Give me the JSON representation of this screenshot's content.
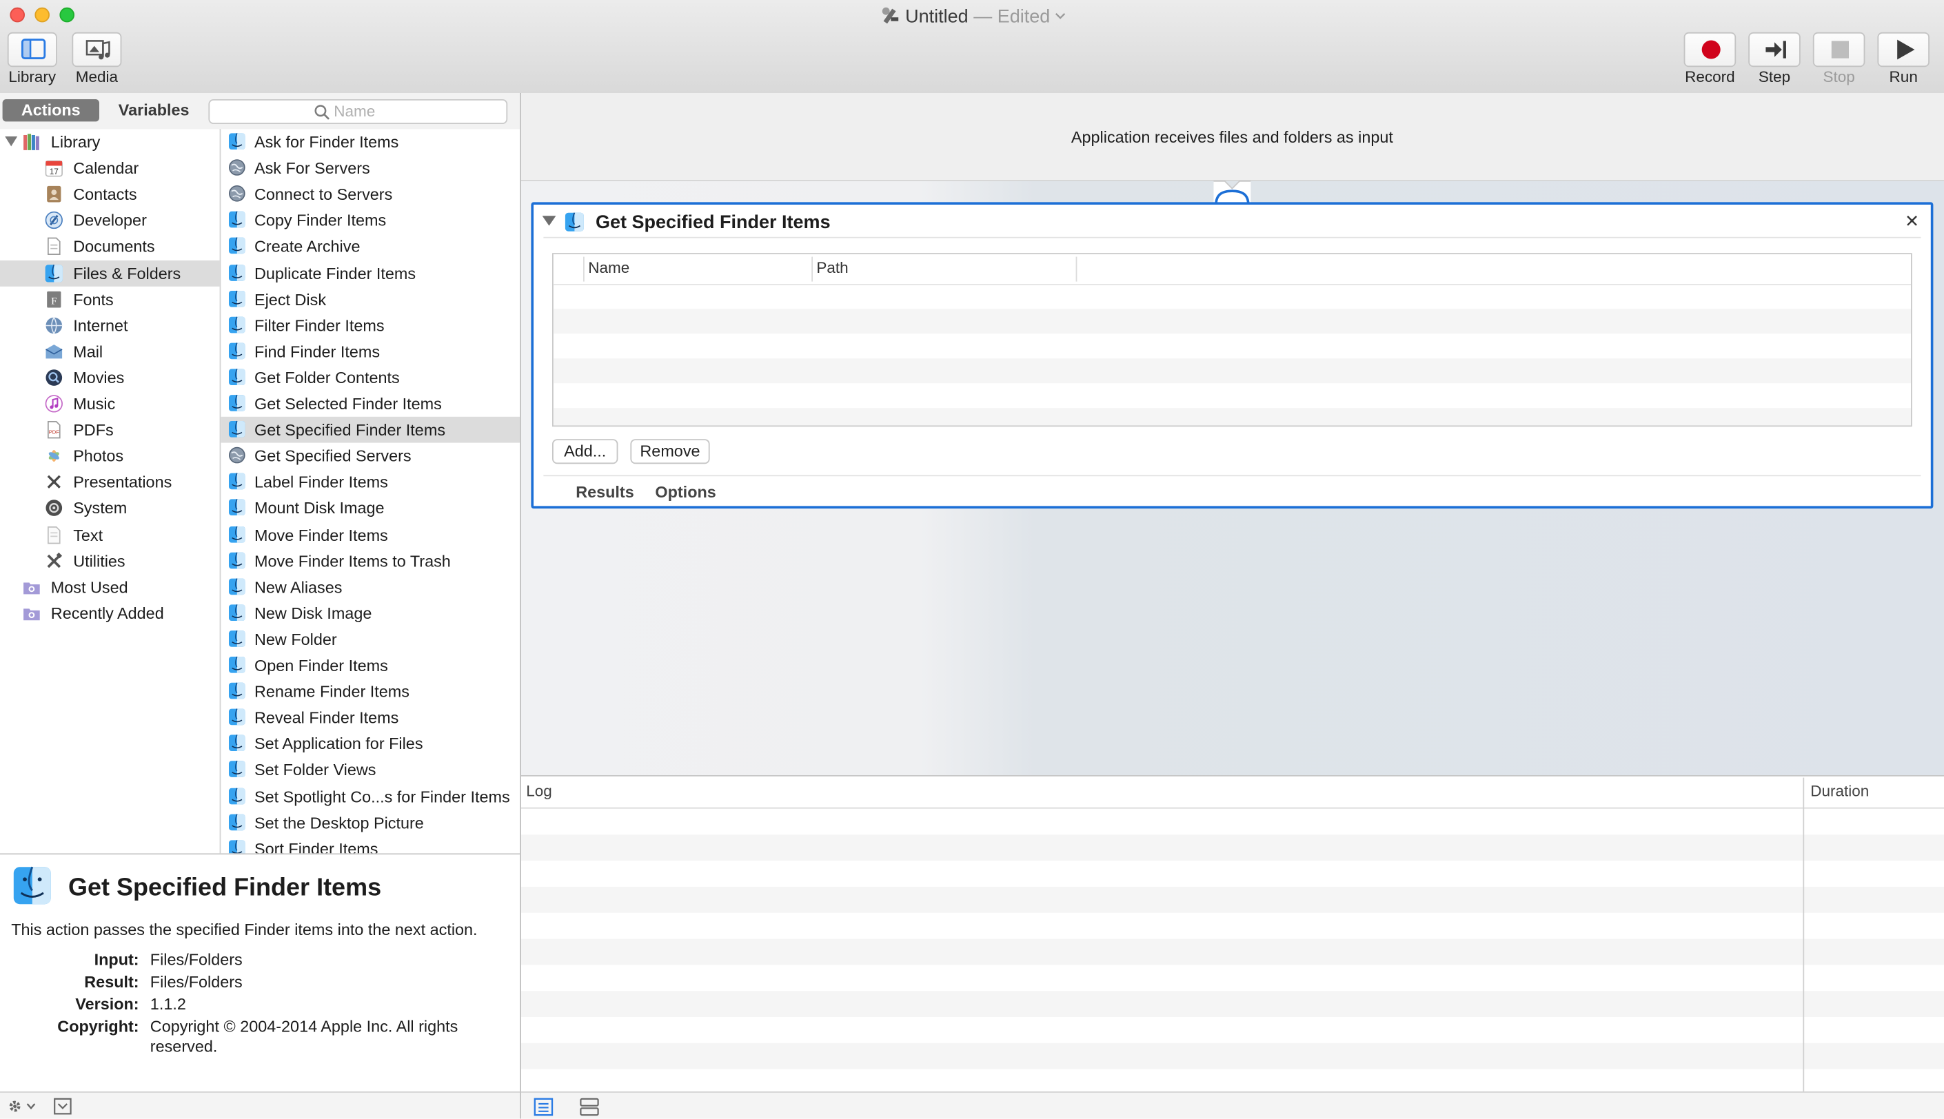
{
  "window": {
    "title": "Untitled",
    "title_separator": "—",
    "edited": "Edited"
  },
  "toolbar": {
    "library_label": "Library",
    "media_label": "Media",
    "record_label": "Record",
    "step_label": "Step",
    "stop_label": "Stop",
    "run_label": "Run",
    "record_color": "#d0021b"
  },
  "tabs": {
    "actions": "Actions",
    "variables": "Variables"
  },
  "search": {
    "placeholder": "Name",
    "value": ""
  },
  "categories": [
    {
      "label": "Library",
      "icon": "library-icon",
      "root": true
    },
    {
      "label": "Calendar",
      "icon": "calendar-icon"
    },
    {
      "label": "Contacts",
      "icon": "contacts-icon"
    },
    {
      "label": "Developer",
      "icon": "developer-icon"
    },
    {
      "label": "Documents",
      "icon": "documents-icon"
    },
    {
      "label": "Files & Folders",
      "icon": "finder-icon",
      "selected": true
    },
    {
      "label": "Fonts",
      "icon": "fonts-icon"
    },
    {
      "label": "Internet",
      "icon": "internet-icon"
    },
    {
      "label": "Mail",
      "icon": "mail-icon"
    },
    {
      "label": "Movies",
      "icon": "movies-icon"
    },
    {
      "label": "Music",
      "icon": "music-icon"
    },
    {
      "label": "PDFs",
      "icon": "pdf-icon"
    },
    {
      "label": "Photos",
      "icon": "photos-icon"
    },
    {
      "label": "Presentations",
      "icon": "presentations-icon"
    },
    {
      "label": "System",
      "icon": "system-icon"
    },
    {
      "label": "Text",
      "icon": "text-icon"
    },
    {
      "label": "Utilities",
      "icon": "utilities-icon"
    },
    {
      "label": "Most Used",
      "icon": "smart-folder-icon",
      "root": true
    },
    {
      "label": "Recently Added",
      "icon": "smart-folder-icon",
      "root": true
    }
  ],
  "actions": [
    {
      "label": "Ask for Finder Items",
      "icon": "finder-icon"
    },
    {
      "label": "Ask For Servers",
      "icon": "globe-icon"
    },
    {
      "label": "Connect to Servers",
      "icon": "globe-icon"
    },
    {
      "label": "Copy Finder Items",
      "icon": "finder-icon"
    },
    {
      "label": "Create Archive",
      "icon": "finder-icon"
    },
    {
      "label": "Duplicate Finder Items",
      "icon": "finder-icon"
    },
    {
      "label": "Eject Disk",
      "icon": "finder-icon"
    },
    {
      "label": "Filter Finder Items",
      "icon": "finder-icon"
    },
    {
      "label": "Find Finder Items",
      "icon": "finder-icon"
    },
    {
      "label": "Get Folder Contents",
      "icon": "finder-icon"
    },
    {
      "label": "Get Selected Finder Items",
      "icon": "finder-icon"
    },
    {
      "label": "Get Specified Finder Items",
      "icon": "finder-icon",
      "selected": true
    },
    {
      "label": "Get Specified Servers",
      "icon": "globe-icon"
    },
    {
      "label": "Label Finder Items",
      "icon": "finder-icon"
    },
    {
      "label": "Mount Disk Image",
      "icon": "finder-icon"
    },
    {
      "label": "Move Finder Items",
      "icon": "finder-icon"
    },
    {
      "label": "Move Finder Items to Trash",
      "icon": "finder-icon"
    },
    {
      "label": "New Aliases",
      "icon": "finder-icon"
    },
    {
      "label": "New Disk Image",
      "icon": "finder-icon"
    },
    {
      "label": "New Folder",
      "icon": "finder-icon"
    },
    {
      "label": "Open Finder Items",
      "icon": "finder-icon"
    },
    {
      "label": "Rename Finder Items",
      "icon": "finder-icon"
    },
    {
      "label": "Reveal Finder Items",
      "icon": "finder-icon"
    },
    {
      "label": "Set Application for Files",
      "icon": "finder-icon"
    },
    {
      "label": "Set Folder Views",
      "icon": "finder-icon"
    },
    {
      "label": "Set Spotlight Co...s for Finder Items",
      "icon": "finder-icon"
    },
    {
      "label": "Set the Desktop Picture",
      "icon": "finder-icon"
    },
    {
      "label": "Sort Finder Items",
      "icon": "finder-icon"
    }
  ],
  "description": {
    "title": "Get Specified Finder Items",
    "text": "This action passes the specified Finder items into the next action.",
    "input_label": "Input:",
    "input_value": "Files/Folders",
    "result_label": "Result:",
    "result_value": "Files/Folders",
    "version_label": "Version:",
    "version_value": "1.1.2",
    "copyright_label": "Copyright:",
    "copyright_value": "Copyright © 2004-2014 Apple Inc.  All rights reserved."
  },
  "workflow": {
    "input_text": "Application receives files and folders as input",
    "action_title": "Get Specified Finder Items",
    "columns": [
      "Name",
      "Path"
    ],
    "add_button": "Add...",
    "remove_button": "Remove",
    "results_tab": "Results",
    "options_tab": "Options",
    "accent_color": "#1c6fd6"
  },
  "log": {
    "log_header": "Log",
    "duration_header": "Duration"
  }
}
